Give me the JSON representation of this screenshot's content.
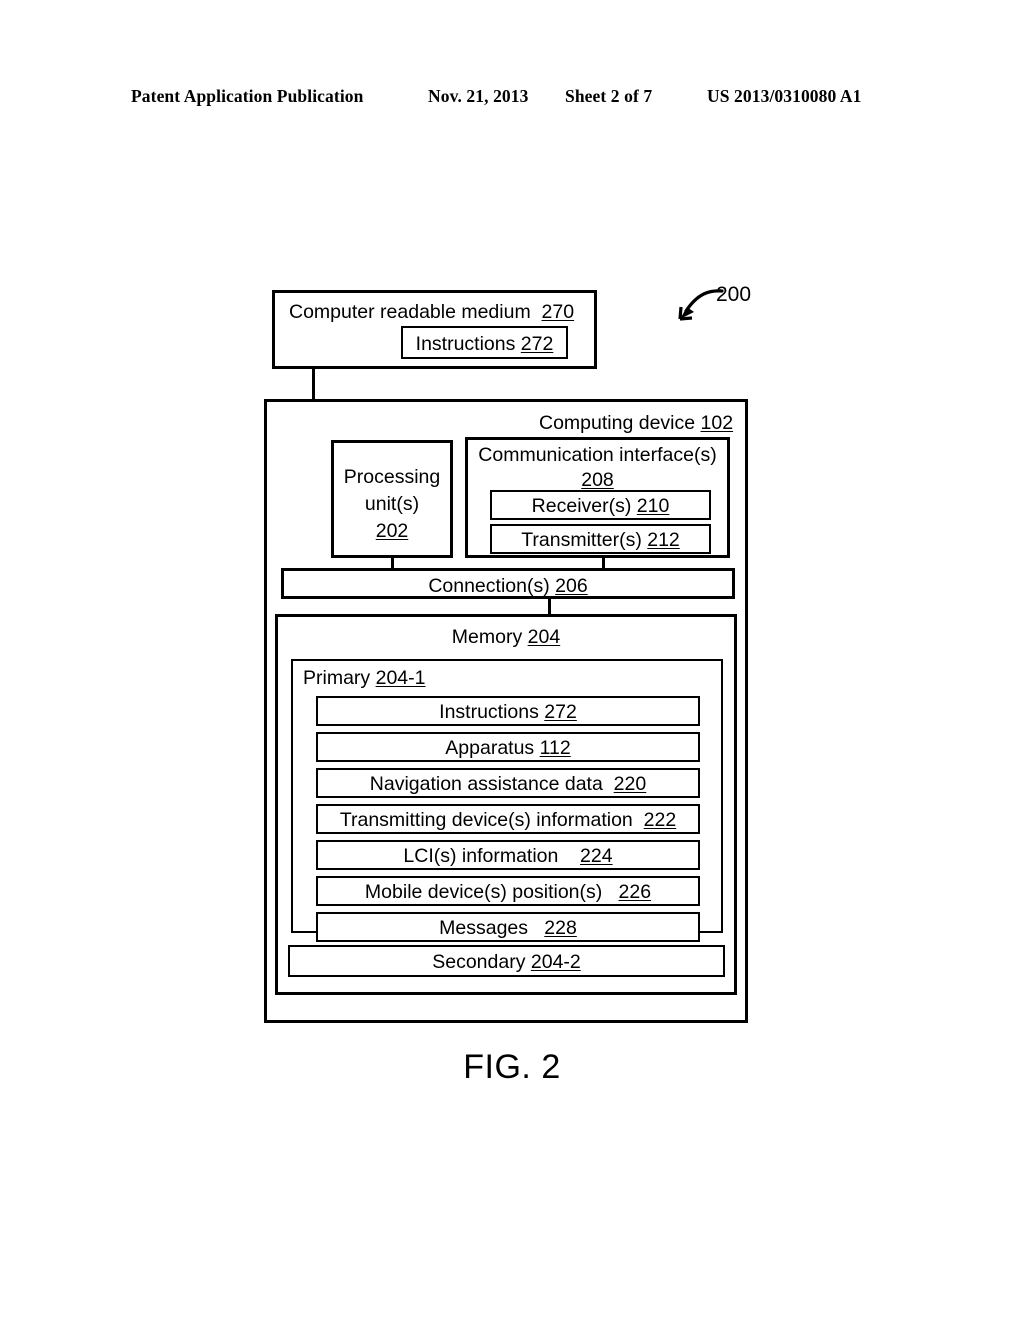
{
  "header": {
    "publication": "Patent Application Publication",
    "date": "Nov. 21, 2013",
    "sheet": "Sheet 2 of 7",
    "patent_number": "US 2013/0310080 A1"
  },
  "figure": {
    "caption": "FIG. 2",
    "callout_label": "200",
    "callout_icon": "curved-arrow-down-left-icon"
  },
  "diagram": {
    "crm": {
      "title": "Computer readable medium",
      "ref": "270",
      "instructions": {
        "title": "Instructions",
        "ref": "272"
      }
    },
    "computing_device": {
      "title": "Computing device",
      "ref": "102",
      "processing_unit": {
        "line1": "Processing",
        "line2": "unit(s)",
        "ref": "202"
      },
      "comm_interface": {
        "title": "Communication interface(s)",
        "ref": "208",
        "receiver": {
          "title": "Receiver(s)",
          "ref": "210"
        },
        "transmitter": {
          "title": "Transmitter(s)",
          "ref": "212"
        }
      },
      "connection": {
        "title": "Connection(s)",
        "ref": "206"
      },
      "memory": {
        "title": "Memory",
        "ref": "204",
        "primary": {
          "title": "Primary",
          "ref": "204-1",
          "items": [
            {
              "title": "Instructions",
              "ref": "272"
            },
            {
              "title": "Apparatus",
              "ref": "112"
            },
            {
              "title": "Navigation assistance data",
              "ref": "220"
            },
            {
              "title": "Transmitting device(s) information",
              "ref": "222"
            },
            {
              "title": "LCI(s) information",
              "ref": "224"
            },
            {
              "title": "Mobile device(s) position(s)",
              "ref": "226"
            },
            {
              "title": "Messages",
              "ref": "228"
            }
          ]
        },
        "secondary": {
          "title": "Secondary",
          "ref": "204-2"
        }
      }
    }
  }
}
